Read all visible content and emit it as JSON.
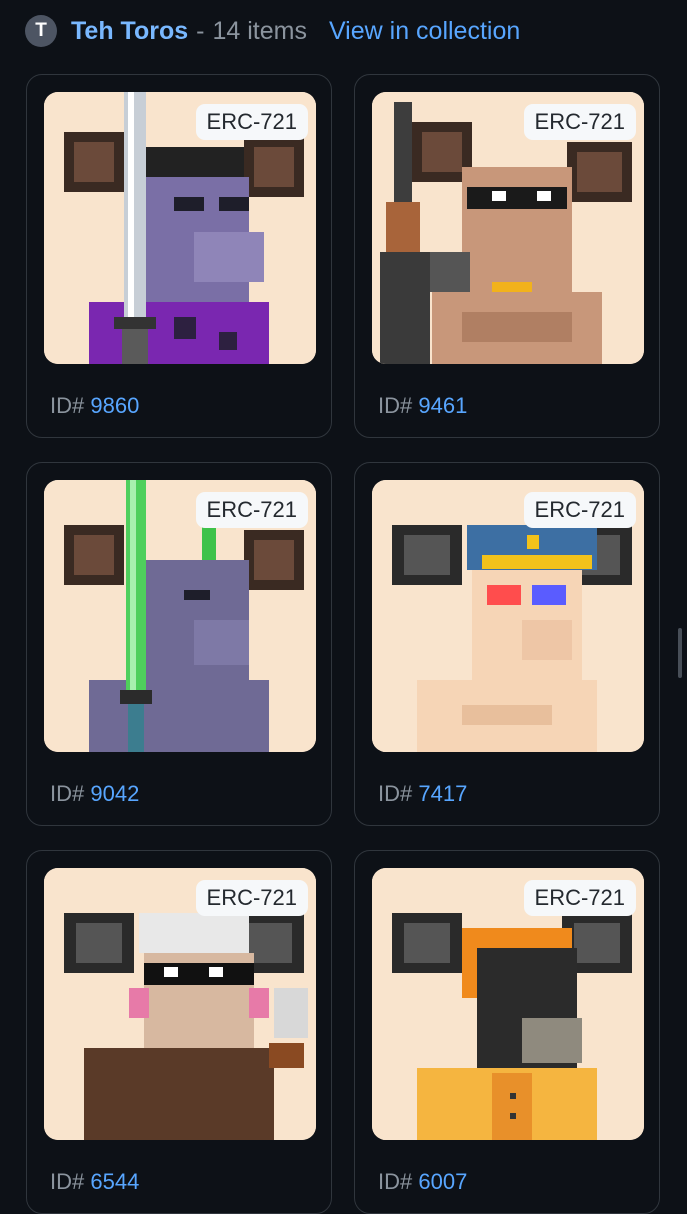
{
  "header": {
    "avatar_letter": "T",
    "collection_name": "Teh Toros",
    "separator": "-",
    "item_count": "14 items",
    "view_link": "View in collection"
  },
  "colors": {
    "background": "#0d1117",
    "card_border": "#30363d",
    "link": "#58a6ff",
    "art_background": "#f9e4cd"
  },
  "cards": [
    {
      "badge": "ERC-721",
      "id_prefix": "ID#",
      "id": "9860",
      "art": "purple bull with sword, purple shirt"
    },
    {
      "badge": "ERC-721",
      "id_prefix": "ID#",
      "id": "9461",
      "art": "tan bull with sunglasses and shotgun"
    },
    {
      "badge": "ERC-721",
      "id_prefix": "ID#",
      "id": "9042",
      "art": "purple bull with green lightsaber and mohawk"
    },
    {
      "badge": "ERC-721",
      "id_prefix": "ID#",
      "id": "7417",
      "art": "beige bull with police cap and 3D glasses"
    },
    {
      "badge": "ERC-721",
      "id_prefix": "ID#",
      "id": "6544",
      "art": "brown bull with cap, sunglasses and pipe"
    },
    {
      "badge": "ERC-721",
      "id_prefix": "ID#",
      "id": "6007",
      "art": "black bull with orange hood and shirt"
    }
  ]
}
